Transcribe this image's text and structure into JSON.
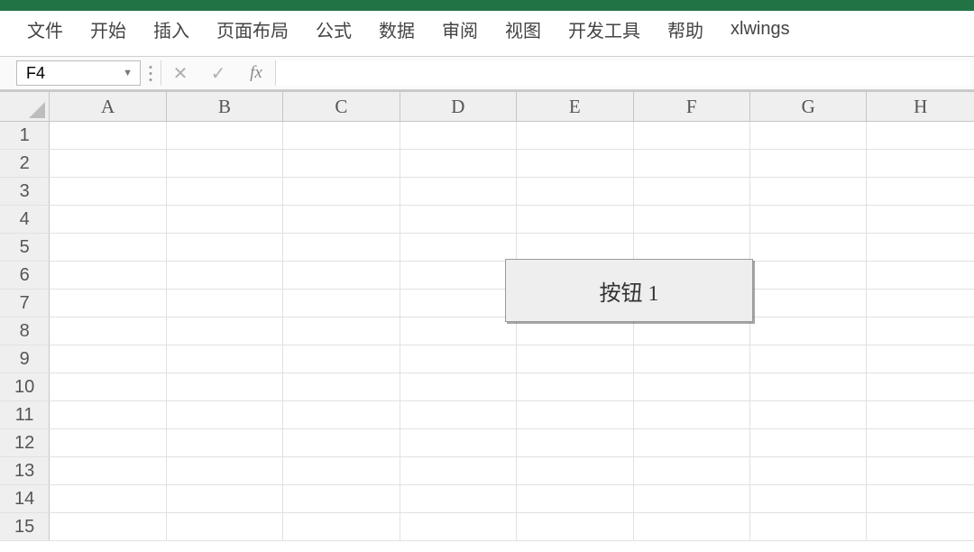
{
  "ribbon": {
    "tabs": [
      "文件",
      "开始",
      "插入",
      "页面布局",
      "公式",
      "数据",
      "审阅",
      "视图",
      "开发工具",
      "帮助",
      "xlwings"
    ]
  },
  "formula_bar": {
    "name_box_value": "F4",
    "cancel_glyph": "✕",
    "confirm_glyph": "✓",
    "fx_label": "fx",
    "formula_value": ""
  },
  "grid": {
    "columns": [
      "A",
      "B",
      "C",
      "D",
      "E",
      "F",
      "G",
      "H"
    ],
    "rows": [
      "1",
      "2",
      "3",
      "4",
      "5",
      "6",
      "7",
      "8",
      "9",
      "10",
      "11",
      "12",
      "13",
      "14",
      "15"
    ]
  },
  "button": {
    "label": "按钮 1"
  }
}
